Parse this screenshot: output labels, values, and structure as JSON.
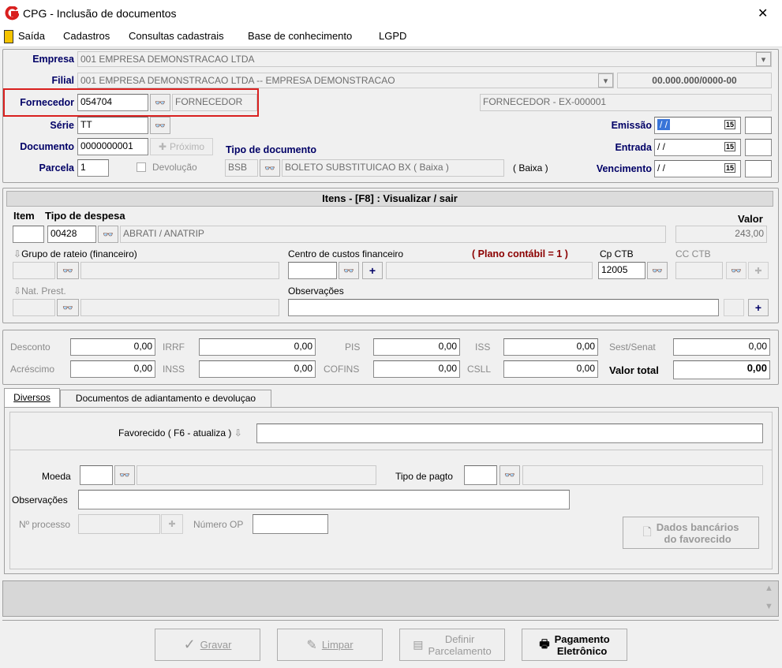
{
  "window": {
    "title": "CPG - Inclusão de documentos",
    "close_glyph": "✕"
  },
  "menu": [
    "Saída",
    "Cadastros",
    "Consultas cadastrais",
    "Base de conhecimento",
    "LGPD"
  ],
  "header": {
    "empresa_label": "Empresa",
    "empresa_value": "001 EMPRESA DEMONSTRACAO LTDA",
    "filial_label": "Filial",
    "filial_value": "001 EMPRESA DEMONSTRACAO LTDA -- EMPRESA DEMONSTRACAO",
    "cnpj": "00.000.000/0000-00",
    "fornecedor_label": "Fornecedor",
    "fornecedor_code": "054704",
    "fornecedor_name": "FORNECEDOR",
    "fornecedor_desc": "FORNECEDOR - EX-000001",
    "serie_label": "Série",
    "serie_value": "TT",
    "documento_label": "Documento",
    "documento_value": "0000000001",
    "proximo_label": "Próximo",
    "tipo_doc_label": "Tipo de documento",
    "parcela_label": "Parcela",
    "parcela_value": "1",
    "devolucao_label": "Devolução",
    "tipo_doc_code": "BSB",
    "tipo_doc_name": "BOLETO SUBSTITUICAO BX ( Baixa )",
    "tipo_doc_extra": "( Baixa )",
    "emissao_label": "Emissão",
    "emissao_value": "/ /",
    "entrada_label": "Entrada",
    "entrada_value": "/ /",
    "vencimento_label": "Vencimento",
    "vencimento_value": "/ /",
    "calendar_glyph": "15"
  },
  "itens": {
    "title": "Itens  - [F8] : Visualizar / sair",
    "item_label": "Item",
    "tipo_despesa_label": "Tipo de despesa",
    "tipo_despesa_code": "00428",
    "tipo_despesa_name": "ABRATI / ANATRIP",
    "valor_label": "Valor",
    "valor_value": "243,00",
    "grupo_rateio_label": "Grupo de rateio (financeiro)",
    "centro_custos_label": "Centro de custos financeiro",
    "plano_contabil": "( Plano contábil = 1 )",
    "cp_ctb_label": "Cp CTB",
    "cp_ctb_value": "12005",
    "cc_ctb_label": "CC CTB",
    "nat_prest_label": "Nat. Prest.",
    "observacoes_label": "Observações"
  },
  "totals": {
    "desconto_label": "Desconto",
    "desconto": "0,00",
    "irrf_label": "IRRF",
    "irrf": "0,00",
    "pis_label": "PIS",
    "pis": "0,00",
    "iss_label": "ISS",
    "iss": "0,00",
    "sest_label": "Sest/Senat",
    "sest": "0,00",
    "acrescimo_label": "Acréscimo",
    "acrescimo": "0,00",
    "inss_label": "INSS",
    "inss": "0,00",
    "cofins_label": "COFINS",
    "cofins": "0,00",
    "csll_label": "CSLL",
    "csll": "0,00",
    "valor_total_label": "Valor total",
    "valor_total": "0,00"
  },
  "tabs": [
    "Diversos",
    "Documentos de adiantamento e devoluçao"
  ],
  "diversos": {
    "favorecido_label": "Favorecido ( F6 - atualiza )",
    "moeda_label": "Moeda",
    "tipo_pagto_label": "Tipo de pagto",
    "observacoes_label": "Observações",
    "processo_label": "Nº processo",
    "numero_op_label": "Número OP",
    "dados_bancarios_line1": "Dados bancários",
    "dados_bancarios_line2": "do favorecido"
  },
  "footer": {
    "gravar": "Gravar",
    "limpar": "Limpar",
    "definir_line1": "Definir",
    "definir_line2": "Parcelamento",
    "pagamento_line1": "Pagamento",
    "pagamento_line2": "Eletrônico"
  },
  "colors": {
    "highlight_border": "#d9201f",
    "label_blue": "#000066",
    "plano_red": "#8b0000"
  }
}
